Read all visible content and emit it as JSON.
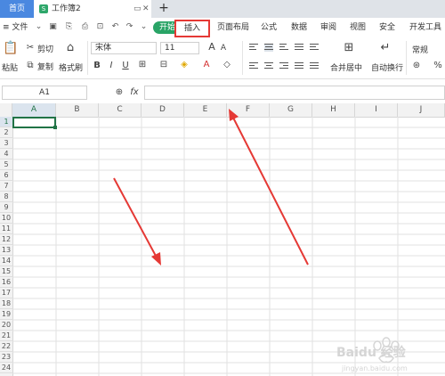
{
  "tabs": {
    "home": "首页",
    "document": "工作簿2"
  },
  "menu": {
    "file": "≡ 文件",
    "items": [
      "开始",
      "插入",
      "页面布局",
      "公式",
      "数据",
      "审阅",
      "视图",
      "安全",
      "开发工具"
    ]
  },
  "ribbon": {
    "paste": "粘贴",
    "cut": "剪切",
    "copy": "复制",
    "format_painter": "格式刷",
    "font_name": "宋体",
    "font_size": "11",
    "merge_center": "合并居中",
    "wrap_text": "自动换行",
    "number_format": "常规"
  },
  "formula_bar": {
    "cell_ref": "A1",
    "fx": "fx"
  },
  "grid": {
    "columns": [
      "A",
      "B",
      "C",
      "D",
      "E",
      "F",
      "G",
      "H",
      "I",
      "J"
    ],
    "rows": [
      "1",
      "2",
      "3",
      "4",
      "5",
      "6",
      "7",
      "8",
      "9",
      "10",
      "11",
      "12",
      "13",
      "14",
      "15",
      "16",
      "17",
      "18",
      "19",
      "20",
      "21",
      "22",
      "23",
      "24"
    ]
  },
  "colors": {
    "accent_green": "#29a466",
    "highlight_red": "#e53935",
    "arrow_red": "#e53935",
    "tab_blue": "#4a88e0"
  },
  "watermark": {
    "text": "Baidu 经验",
    "subtext": "jingyan.baidu.com"
  }
}
